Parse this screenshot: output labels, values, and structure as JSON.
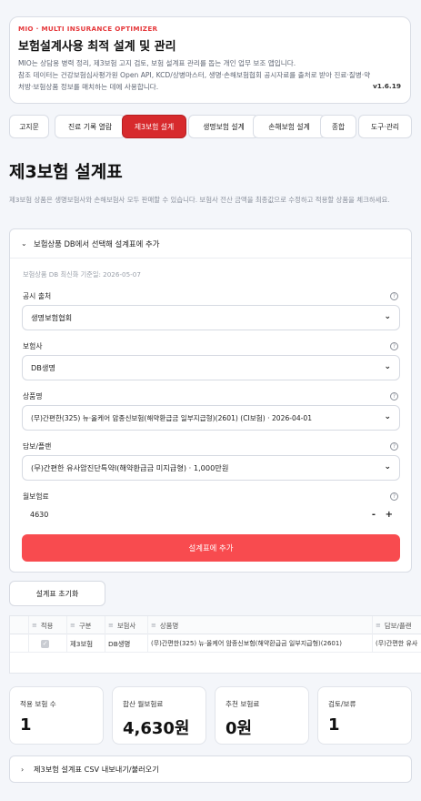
{
  "header": {
    "brand": "MIO · MULTI INSURANCE OPTIMIZER",
    "title": "보험설계사용 최적 설계 및 관리",
    "desc_1": "MIO는 상담용 병력 정리, 제3보험 고지 검토, 보험 설계표 관리를 돕는 개인 업무 보조 앱입니다.",
    "desc_2": "참조 데이터는 건강보험심사평가원 Open API, KCD/상병마스터, 생명·손해보험협회 공시자료를 출처로 받아 진료·질병·약처방·보험상품 정보를 매치하는 데에 사용합니다.",
    "version": "v1.6.19"
  },
  "tabs": [
    {
      "label": "고지문"
    },
    {
      "label": "진료 기록 열람"
    },
    {
      "label": "제3보험 설계"
    },
    {
      "label": "생명보험 설계"
    },
    {
      "label": "손해보험 설계"
    },
    {
      "label": "종합"
    },
    {
      "label": "도구·관리"
    }
  ],
  "active_tab": "제3보험 설계",
  "page": {
    "title": "제3보험 설계표",
    "intro": "제3보험 상품은 생명보험사와 손해보험사 모두 판매할 수 있습니다. 보험사 전산 금액을 최종값으로 수정하고 적용할 상품을 체크하세요."
  },
  "product_picker": {
    "header": "보험상품 DB에서 선택해 설계표에 추가",
    "db_updated": "보험상품 DB 최신화 기준일: 2026-05-07",
    "fields": {
      "publisher": {
        "label": "공시 출처",
        "value": "생명보험협회"
      },
      "insurer": {
        "label": "보험사",
        "value": "DB생명"
      },
      "product": {
        "label": "상품명",
        "value": "(무)간편한(325) 뉴·올케어 암종신보험(해약환급금 일부지급형)(2601) (CI보험) · 2026-04-01"
      },
      "rider": {
        "label": "담보/플랜",
        "value": "(무)간편한 유사암진단특약Ⅰ(해약환급금 미지급형) · 1,000만원"
      },
      "premium": {
        "label": "월보험료",
        "value": "4630",
        "minus": "-",
        "plus": "+"
      }
    },
    "help_glyph": "?",
    "add_button": "설계표에 추가"
  },
  "reset_button": "설계표 초기화",
  "table": {
    "headers": [
      "적용",
      "구분",
      "보험사",
      "상품명",
      "담보/플랜"
    ],
    "rows": [
      {
        "applied": true,
        "category": "제3보험",
        "insurer": "DB생명",
        "product": "(무)간편한(325) 뉴·올케어 암종신보험(해약환급금 일부지급형)(2601)",
        "plan": "(무)간편한 유사"
      }
    ]
  },
  "metrics": [
    {
      "label": "적용 보험 수",
      "value": "1"
    },
    {
      "label": "합산 월보험료",
      "value": "4,630원"
    },
    {
      "label": "추천 보험료",
      "value": "0원"
    },
    {
      "label": "검토/보류",
      "value": "1"
    }
  ],
  "csv_expander": "제3보험 설계표 CSV 내보내기/불러오기",
  "colors": {
    "accent": "#d72a2d",
    "add_button": "#f84b4f",
    "brand": "#e5383b"
  }
}
